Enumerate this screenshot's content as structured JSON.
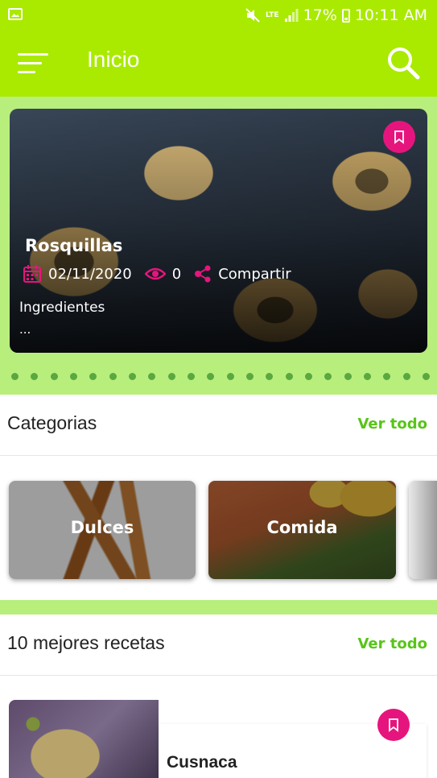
{
  "status_bar": {
    "battery": "17%",
    "time": "10:11 AM",
    "network": "LTE"
  },
  "header": {
    "title": "Inicio"
  },
  "featured": {
    "title": "Rosquillas",
    "date": "02/11/2020",
    "views": "0",
    "share_label": "Compartir",
    "subtitle": "Ingredientes",
    "excerpt": "..."
  },
  "categories": {
    "title": "Categorias",
    "see_all": "Ver todo",
    "items": [
      {
        "label": "Dulces"
      },
      {
        "label": "Comida"
      }
    ]
  },
  "top_recipes": {
    "title": "10 mejores recetas",
    "see_all": "Ver todo",
    "items": [
      {
        "title": "Cusnaca"
      }
    ]
  },
  "colors": {
    "primary": "#a9ea00",
    "accent": "#e6157d",
    "link": "#58c418",
    "band": "#b8ee7c"
  }
}
